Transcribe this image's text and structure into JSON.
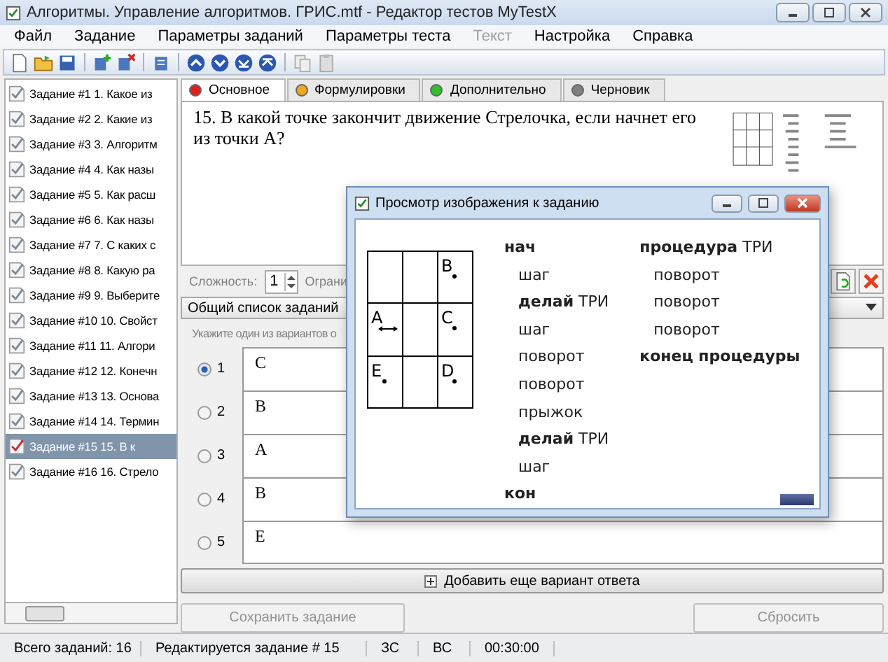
{
  "window": {
    "title": "Алгоритмы. Управление алгоритмов. ГРИС.mtf - Редактор тестов MyTestX"
  },
  "menu": [
    {
      "label": "Файл",
      "disabled": false
    },
    {
      "label": "Задание",
      "disabled": false
    },
    {
      "label": "Параметры заданий",
      "disabled": false
    },
    {
      "label": "Параметры теста",
      "disabled": false
    },
    {
      "label": "Текст",
      "disabled": true
    },
    {
      "label": "Настройка",
      "disabled": false
    },
    {
      "label": "Справка",
      "disabled": false
    }
  ],
  "tasks": [
    {
      "label": "Задание #1 1. Какое из",
      "selected": false
    },
    {
      "label": "Задание #2 2. Какие из",
      "selected": false
    },
    {
      "label": "Задание #3 3. Алгоритм",
      "selected": false
    },
    {
      "label": "Задание #4 4. Как назы",
      "selected": false
    },
    {
      "label": "Задание #5 5. Как расш",
      "selected": false
    },
    {
      "label": "Задание #6 6. Как назы",
      "selected": false
    },
    {
      "label": "Задание #7 7. С каких с",
      "selected": false
    },
    {
      "label": "Задание #8 8. Какую ра",
      "selected": false
    },
    {
      "label": "Задание #9 9. Выберите",
      "selected": false
    },
    {
      "label": "Задание #10 10. Свойст",
      "selected": false
    },
    {
      "label": "Задание #11 11. Алгори",
      "selected": false
    },
    {
      "label": "Задание #12 12. Конечн",
      "selected": false
    },
    {
      "label": "Задание #13 13. Основа",
      "selected": false
    },
    {
      "label": "Задание #14 14. Термин",
      "selected": false
    },
    {
      "label": "Задание #15 15. В к",
      "selected": true
    },
    {
      "label": "Задание #16 16. Стрело",
      "selected": false
    }
  ],
  "tabs": [
    {
      "label": "Основное",
      "selected": true,
      "color": "#e02020"
    },
    {
      "label": "Формулировки",
      "selected": false,
      "color": "#f0a820"
    },
    {
      "label": "Дополнительно",
      "selected": false,
      "color": "#30c030"
    },
    {
      "label": "Черновик",
      "selected": false,
      "color": "#808080"
    }
  ],
  "question": "15. В какой точке закончит движение Стрелочка, если начнет его из точки А?",
  "complexity": {
    "label": "Сложность:",
    "value": "1",
    "next_label": "Ограни"
  },
  "list_dropdown": {
    "value": "Общий список заданий"
  },
  "hint": "Укажите один из вариантов о",
  "answers": [
    {
      "number": "1",
      "text": "C",
      "selected": true
    },
    {
      "number": "2",
      "text": "B",
      "selected": false
    },
    {
      "number": "3",
      "text": "A",
      "selected": false
    },
    {
      "number": "4",
      "text": "B",
      "selected": false
    },
    {
      "number": "5",
      "text": "E",
      "selected": false
    }
  ],
  "add_button": "Добавить еще вариант ответа",
  "save_button": "Сохранить задание",
  "reset_button": "Сбросить",
  "status_bar": [
    "Всего заданий: 16",
    "Редактируется задание # 15",
    "ЗС",
    "ВС",
    "00:30:00"
  ],
  "dialog": {
    "title": "Просмотр изображения к заданию",
    "grid": [
      [
        {
          "kind": "empty"
        },
        {
          "kind": "empty"
        },
        {
          "kind": "point",
          "label": "B"
        }
      ],
      [
        {
          "kind": "start",
          "label": "A"
        },
        {
          "kind": "empty"
        },
        {
          "kind": "point",
          "label": "C"
        }
      ],
      [
        {
          "kind": "point",
          "label": "E"
        },
        {
          "kind": "empty"
        },
        {
          "kind": "point",
          "label": "D"
        }
      ]
    ],
    "left_program": [
      {
        "text": "нач",
        "bold": true,
        "children": [
          {
            "text": "шаг",
            "bold": false
          },
          {
            "text": "**делай** ТРИ",
            "bold": false
          },
          {
            "text": "шаг",
            "bold": false
          },
          {
            "text": "поворот",
            "bold": false
          },
          {
            "text": "поворот",
            "bold": false
          },
          {
            "text": "прыжок",
            "bold": false
          },
          {
            "text": "**делай** ТРИ",
            "bold": false
          },
          {
            "text": "шаг",
            "bold": false
          }
        ]
      },
      {
        "text": "кон",
        "bold": true
      }
    ],
    "right_program": [
      {
        "text": "**процедура** ТРИ",
        "bold": false,
        "children": [
          {
            "text": "поворот",
            "bold": false
          },
          {
            "text": "поворот",
            "bold": false
          },
          {
            "text": "поворот",
            "bold": false
          }
        ]
      },
      {
        "text": "конец процедуры",
        "bold": true
      }
    ]
  }
}
